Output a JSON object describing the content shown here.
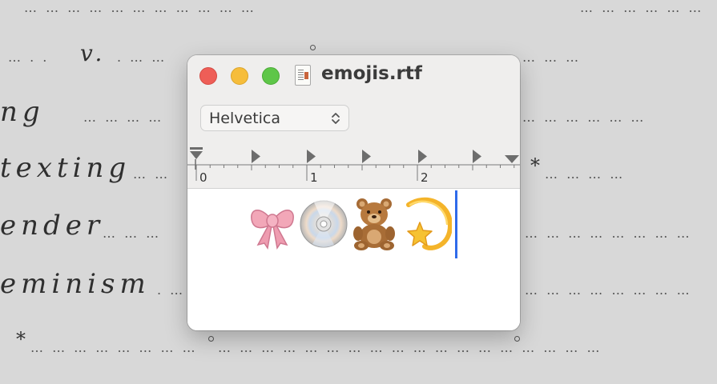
{
  "background": {
    "script_words": [
      "ng",
      "texting",
      "ender",
      "eminism",
      "v."
    ],
    "star": "*"
  },
  "window": {
    "title": "emojis.rtf",
    "font_select": {
      "value": "Helvetica"
    },
    "ruler": {
      "labels": [
        "0",
        "1",
        "2"
      ]
    },
    "content": {
      "emojis": [
        {
          "name": "ribbon",
          "char": "🎀"
        },
        {
          "name": "optical-disc",
          "char": "💿"
        },
        {
          "name": "teddy-bear",
          "char": "🧸"
        },
        {
          "name": "dizzy-star",
          "char": "💫"
        }
      ]
    }
  },
  "colors": {
    "close": "#ee5e57",
    "minimize": "#f6bd3b",
    "maximize": "#5ec648",
    "cursor": "#2f6bea"
  }
}
